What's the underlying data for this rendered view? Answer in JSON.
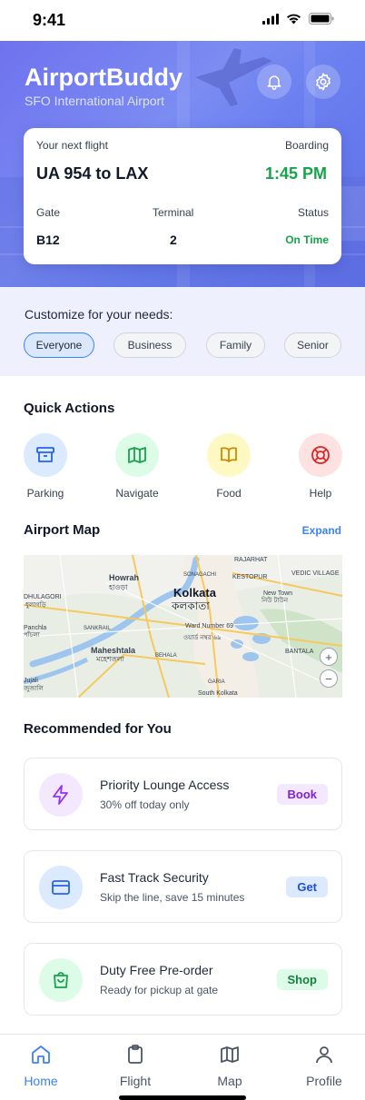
{
  "status_bar": {
    "time": "9:41"
  },
  "header": {
    "title": "AirportBuddy",
    "subtitle": "SFO International Airport",
    "icons": [
      "bell-icon",
      "gear-icon"
    ]
  },
  "flight_card": {
    "label_next": "Your next flight",
    "label_boarding": "Boarding",
    "flight": "UA 954 to LAX",
    "boarding_time": "1:45 PM",
    "gate_label": "Gate",
    "terminal_label": "Terminal",
    "status_label": "Status",
    "gate": "B12",
    "terminal": "2",
    "status": "On Time"
  },
  "customize": {
    "title": "Customize for your needs:",
    "chips": [
      "Everyone",
      "Business",
      "Family",
      "Senior"
    ],
    "selected": "Everyone"
  },
  "quick_actions": {
    "title": "Quick Actions",
    "items": [
      {
        "label": "Parking",
        "icon": "archive-box-icon"
      },
      {
        "label": "Navigate",
        "icon": "map-icon"
      },
      {
        "label": "Food",
        "icon": "book-icon"
      },
      {
        "label": "Help",
        "icon": "lifebuoy-icon"
      }
    ]
  },
  "airport_map": {
    "title": "Airport Map",
    "expand": "Expand",
    "labels": [
      "RAJARHAT",
      "VEDIC VILLAGE",
      "Howrah",
      "হাওড়া",
      "KESTOPUR",
      "Kolkata",
      "কলকাতা",
      "DHULAGORI",
      "ধুলাগড়ি",
      "New Town",
      "নিউ টাউন",
      "SANKRAIL",
      "Panchla",
      "পাঁচলা",
      "Ward Number 69",
      "ওয়ার্ড নম্বর ৬৯",
      "Maheshtala",
      "মহেশতলা",
      "BEHALA",
      "BANTALA",
      "Jujali",
      "জুজালি",
      "GARIA",
      "South Kolkata",
      "SONAGACHI"
    ],
    "zoom_in": "+",
    "zoom_out": "−"
  },
  "recommended": {
    "title": "Recommended for You",
    "items": [
      {
        "title": "Priority Lounge Access",
        "subtitle": "30% off today only",
        "action": "Book",
        "icon": "lightning-icon",
        "color": "#9333ea",
        "bg": "#f3e8ff"
      },
      {
        "title": "Fast Track Security",
        "subtitle": "Skip the line, save 15 minutes",
        "action": "Get",
        "icon": "credit-card-icon",
        "color": "#2563eb",
        "bg": "#dbeafe"
      },
      {
        "title": "Duty Free Pre-order",
        "subtitle": "Ready for pickup at gate",
        "action": "Shop",
        "icon": "shopping-bag-icon",
        "color": "#16a34a",
        "bg": "#dcfce7"
      }
    ]
  },
  "bottom_nav": {
    "items": [
      {
        "label": "Home",
        "icon": "home-icon"
      },
      {
        "label": "Flight",
        "icon": "clipboard-icon"
      },
      {
        "label": "Map",
        "icon": "map-icon"
      },
      {
        "label": "Profile",
        "icon": "user-icon"
      }
    ],
    "active": "Home"
  },
  "colors": {
    "accent": "#3b82f6",
    "success": "#16a34a",
    "hero": "#6f72ee"
  }
}
